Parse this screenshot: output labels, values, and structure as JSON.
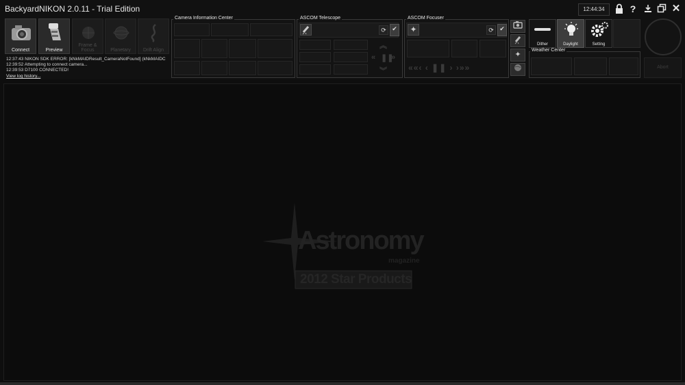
{
  "window": {
    "title": "BackyardNIKON 2.0.11 - Trial Edition",
    "clock": "12:44:34"
  },
  "toolbar": {
    "buttons": [
      {
        "label": "Connect",
        "icon": "camera-icon",
        "enabled": true
      },
      {
        "label": "Preview",
        "icon": "film-roll-icon",
        "enabled": true
      },
      {
        "label": "Frame & Focus",
        "icon": "frame-focus-icon",
        "enabled": false
      },
      {
        "label": "Planetary",
        "icon": "planet-icon",
        "enabled": false
      },
      {
        "label": "Drift Align",
        "icon": "drift-align-icon",
        "enabled": false
      }
    ]
  },
  "log": {
    "lines": [
      "12:37:43   NIKON SDK ERROR: [kNkMAIDResult_CameraNotFound] (kNkMAIDC",
      "12:39:52   Attempting to connect camera...",
      "12:39:53   D7100 CONNECTED!"
    ],
    "history_link": "View log history..."
  },
  "panels": {
    "camera_info": {
      "title": "Camera Information Center"
    },
    "telescope": {
      "title": "ASCOM Telescope"
    },
    "focuser": {
      "title": "ASCOM Focuser"
    },
    "weather": {
      "title": "Weather Center"
    }
  },
  "modes": {
    "dither": "Dither",
    "daylight": "Daylight",
    "setting": "Setting"
  },
  "abort": {
    "label": "Abort"
  },
  "watermark": {
    "brand": "Astronomy",
    "sub": "magazine",
    "award": "2012 Star Products"
  },
  "colors": {
    "background": "#0e0e0e",
    "panel_border": "#3a3a3a",
    "text": "#e6e6e6"
  }
}
